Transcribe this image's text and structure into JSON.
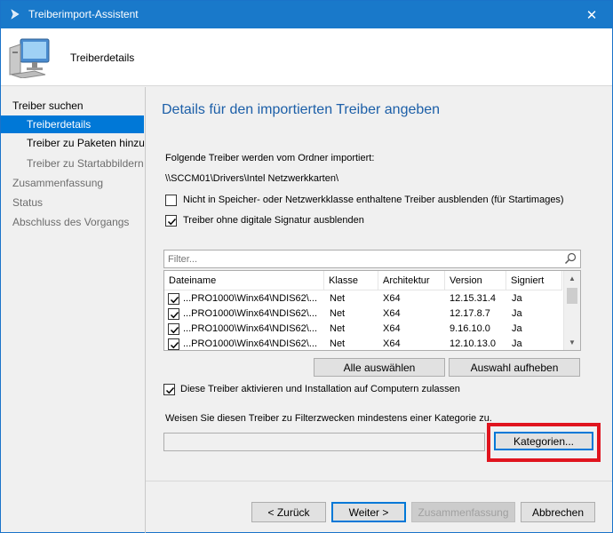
{
  "window": {
    "title": "Treiberimport-Assistent",
    "close_glyph": "✕"
  },
  "header": {
    "title": "Treiberdetails",
    "icon": "computer-icon"
  },
  "sidebar": {
    "items": [
      {
        "label": "Treiber suchen",
        "state": "normal"
      },
      {
        "label": "Treiberdetails",
        "state": "selected"
      },
      {
        "label": "Treiber zu Paketen hinzufügen",
        "state": "normal"
      },
      {
        "label": "Treiber zu Startabbildern",
        "state": "muted"
      },
      {
        "label": "Zusammenfassung",
        "state": "muted"
      },
      {
        "label": "Status",
        "state": "muted"
      },
      {
        "label": "Abschluss des Vorgangs",
        "state": "muted"
      }
    ]
  },
  "main": {
    "title": "Details für den importierten Treiber angeben",
    "import_info": "Folgende Treiber werden vom Ordner importiert:",
    "folder_path": "\\\\SCCM01\\Drivers\\Intel Netzwerkkarten\\",
    "hide_class_checkbox": {
      "label": "Nicht in Speicher- oder Netzwerkklasse enthaltene Treiber ausblenden (für Startimages)",
      "checked": false
    },
    "hide_unsigned_checkbox": {
      "label": "Treiber ohne digitale Signatur ausblenden",
      "checked": true
    },
    "filter_placeholder": "Filter...",
    "table": {
      "columns": [
        "Dateiname",
        "Klasse",
        "Architektur",
        "Version",
        "Signiert"
      ],
      "rows": [
        {
          "checked": true,
          "file": "...PRO1000\\Winx64\\NDIS62\\...",
          "class": "Net",
          "arch": "X64",
          "version": "12.15.31.4",
          "signed": "Ja"
        },
        {
          "checked": true,
          "file": "...PRO1000\\Winx64\\NDIS62\\...",
          "class": "Net",
          "arch": "X64",
          "version": "12.17.8.7",
          "signed": "Ja"
        },
        {
          "checked": true,
          "file": "...PRO1000\\Winx64\\NDIS62\\...",
          "class": "Net",
          "arch": "X64",
          "version": "9.16.10.0",
          "signed": "Ja"
        },
        {
          "checked": true,
          "file": "...PRO1000\\Winx64\\NDIS62\\...",
          "class": "Net",
          "arch": "X64",
          "version": "12.10.13.0",
          "signed": "Ja"
        }
      ]
    },
    "select_all_label": "Alle auswählen",
    "deselect_label": "Auswahl aufheben",
    "enable_checkbox": {
      "label": "Diese Treiber aktivieren und Installation auf Computern zulassen",
      "checked": true
    },
    "category_info": "Weisen Sie diesen Treiber zu Filterzwecken mindestens einer Kategorie zu.",
    "category_value": "",
    "categories_button": "Kategorien...",
    "highlight_color": "#e0141e"
  },
  "footer": {
    "back": "< Zurück",
    "next": "Weiter >",
    "summary": "Zusammenfassung",
    "cancel": "Abbrechen"
  },
  "colors": {
    "titlebar": "#1979ca",
    "selection": "#0078d7",
    "heading": "#1c5fa8"
  }
}
